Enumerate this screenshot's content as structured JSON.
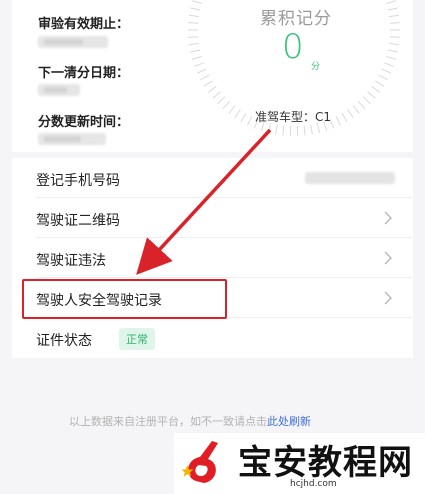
{
  "info": {
    "expiry_label": "审验有效期止：",
    "next_clear_label": "下一清分日期：",
    "update_time_label": "分数更新时间："
  },
  "score": {
    "title": "累积记分",
    "value": "0",
    "unit": "分",
    "vehicle_label": "准驾车型：C1"
  },
  "menu": [
    {
      "label": "登记手机号码"
    },
    {
      "label": "驾驶证二维码"
    },
    {
      "label": "驾驶证违法"
    },
    {
      "label": "驾驶人安全驾驶记录"
    },
    {
      "label": "证件状态",
      "badge": "正常"
    }
  ],
  "footer": {
    "text": "以上数据来自注册平台，如不一致请点击",
    "link": "此处刷新"
  },
  "watermark": {
    "title": "宝安教程网",
    "url": "hcjhd.com"
  },
  "colors": {
    "accent_green": "#35c27a",
    "highlight_red": "#d8232a",
    "link_blue": "#3d6fd6"
  }
}
